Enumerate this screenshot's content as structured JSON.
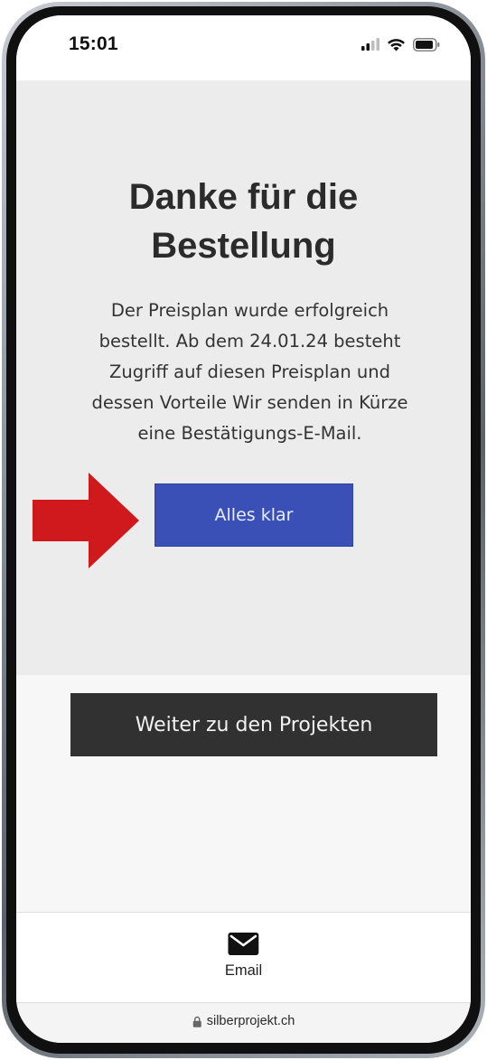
{
  "status_bar": {
    "time": "15:01",
    "icons": [
      "signal-icon",
      "wifi-icon",
      "battery-icon"
    ]
  },
  "confirmation": {
    "title_line1": "Danke für die",
    "title_line2": "Bestellung",
    "message_lines": [
      "Der Preisplan wurde erfolgreich",
      "bestellt. Ab dem 24.01.24 besteht",
      "Zugriff auf diesen Preisplan und",
      "dessen Vorteile Wir senden in Kürze",
      "eine Bestätigungs-E-Mail."
    ],
    "primary_button_label": "Alles klar",
    "primary_button_color": "#3a50b6"
  },
  "annotation": {
    "arrow_color": "#d0191c",
    "points_to": "primary-button"
  },
  "secondary": {
    "button_label": "Weiter zu den Projekten",
    "button_color": "#313131"
  },
  "contact": {
    "icon": "envelope-icon",
    "label": "Email"
  },
  "browser": {
    "url": "silberprojekt.ch",
    "icon": "lock-icon"
  }
}
